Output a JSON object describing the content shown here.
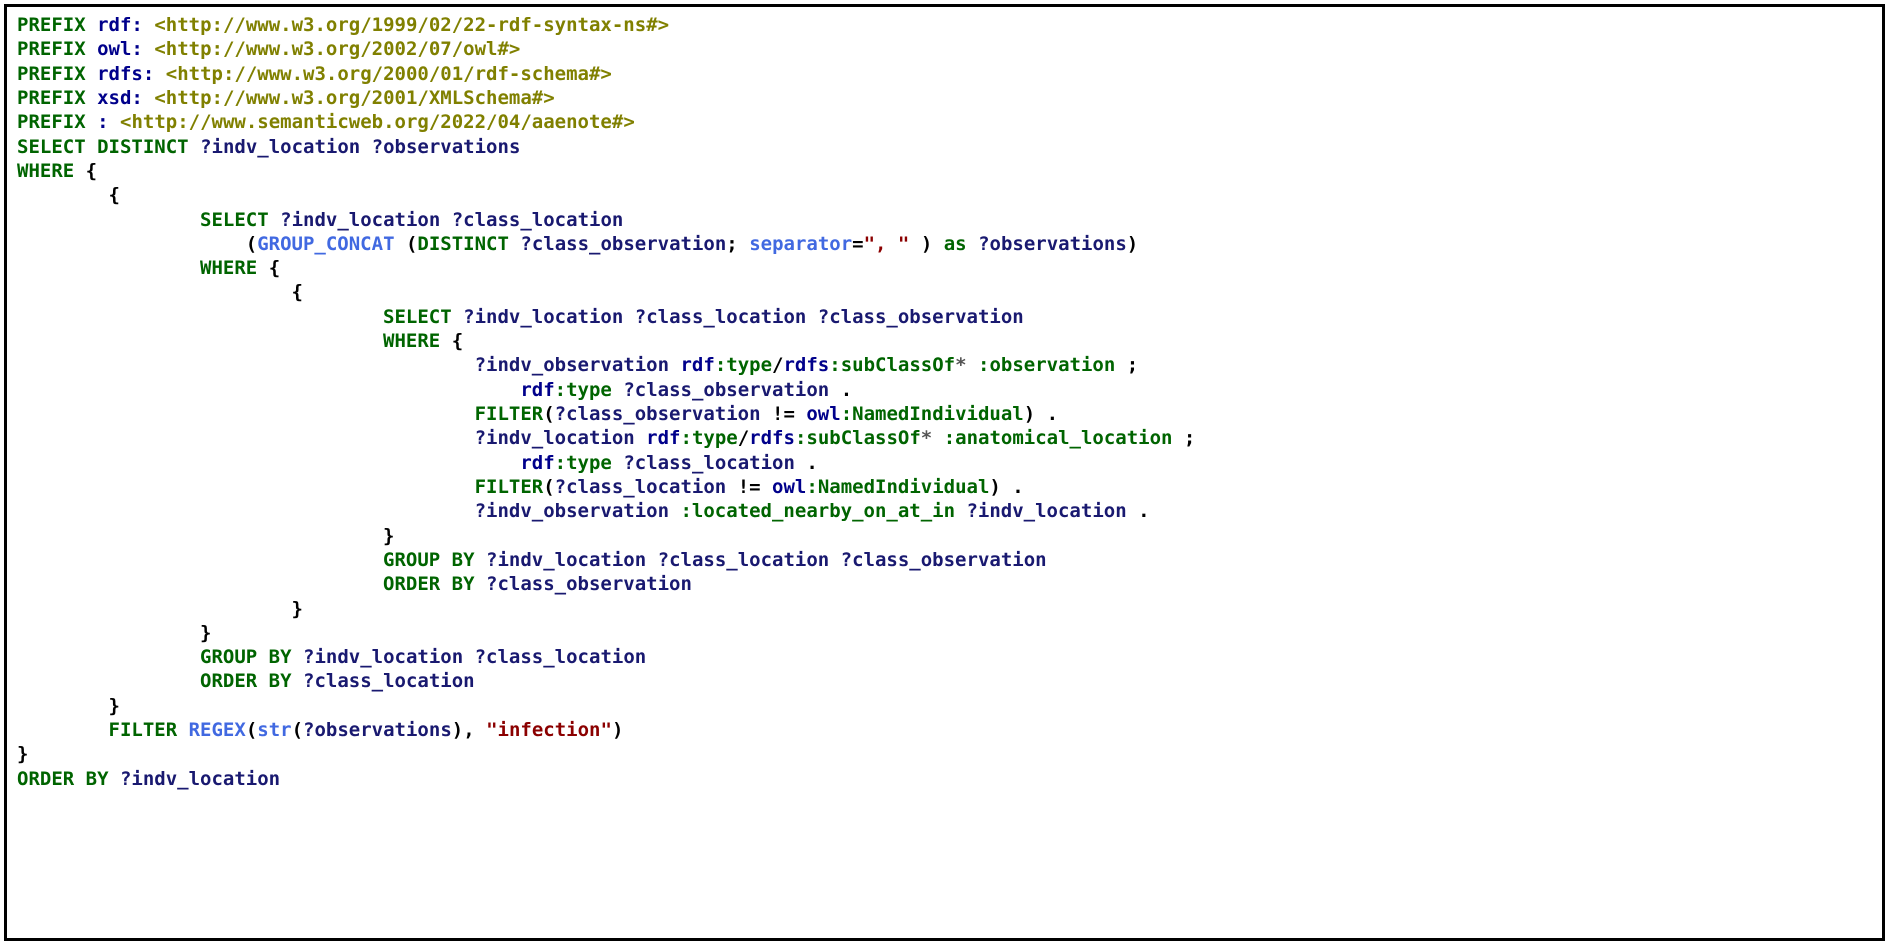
{
  "prefix_kw": "PREFIX",
  "select_kw": "SELECT",
  "distinct_kw": "DISTINCT",
  "where_kw": "WHERE",
  "filter_kw": "FILTER",
  "group_by_kw": "GROUP BY",
  "order_by_kw": "ORDER BY",
  "as_kw": "as",
  "group_concat_fn": "GROUP_CONCAT",
  "regex_fn": "REGEX",
  "str_fn": "str",
  "separator_kw": "separator",
  "prefixes": {
    "rdf": {
      "name": "rdf:",
      "uri": "<http://www.w3.org/1999/02/22-rdf-syntax-ns#>"
    },
    "owl": {
      "name": "owl:",
      "uri": "<http://www.w3.org/2002/07/owl#>"
    },
    "rdfs": {
      "name": "rdfs:",
      "uri": "<http://www.w3.org/2000/01/rdf-schema#>"
    },
    "xsd": {
      "name": "xsd:",
      "uri": "<http://www.w3.org/2001/XMLSchema#>"
    },
    "base": {
      "name": ":",
      "uri": "<http://www.semanticweb.org/2022/04/aaenote#>"
    }
  },
  "vars": {
    "indv_location": "?indv_location",
    "observations": "?observations",
    "class_location": "?class_location",
    "class_observation": "?class_observation",
    "indv_observation": "?indv_observation"
  },
  "qnames": {
    "rdf_type": "rdf",
    "rdf_type_local": "type",
    "rdfs_subclassof": "rdfs",
    "rdfs_subclassof_local": "subClassOf",
    "owl_ni": "owl",
    "owl_ni_local": "NamedIndividual",
    "observation": ":observation",
    "anatomical_location": ":anatomical_location",
    "located": ":located_nearby_on_at_in"
  },
  "strings": {
    "sep": "\", \"",
    "infection": "\"infection\""
  }
}
